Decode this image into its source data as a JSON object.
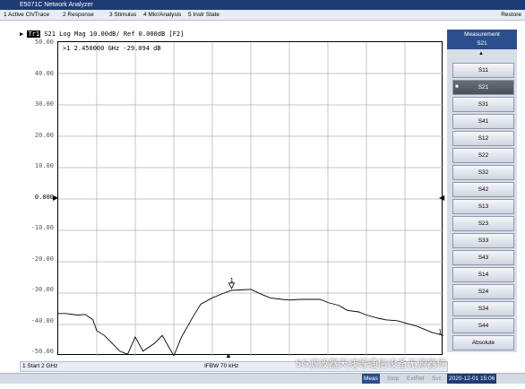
{
  "window": {
    "title": "E5071C Network Analyzer"
  },
  "menu": {
    "items": [
      "1 Active Ch/Trace",
      "2 Response",
      "3 Stimulus",
      "4 Mkr/Analysis",
      "5 Instr State"
    ],
    "right": "Restore"
  },
  "trace_header": {
    "trace_tag": "Tr1",
    "text": "S21 Log Mag 10.00dB/ Ref 0.000dB [F2]"
  },
  "marker_readout": ">1  2.450000 GHz -29.094 dB",
  "marker_label": "1",
  "trace_end_label": "1",
  "chart_data": {
    "type": "line",
    "x": [
      2.0,
      2.02,
      2.05,
      2.07,
      2.09,
      2.1,
      2.12,
      2.14,
      2.16,
      2.18,
      2.2,
      2.22,
      2.25,
      2.27,
      2.3,
      2.32,
      2.35,
      2.37,
      2.4,
      2.43,
      2.45,
      2.47,
      2.5,
      2.53,
      2.55,
      2.58,
      2.6,
      2.63,
      2.65,
      2.68,
      2.7,
      2.73,
      2.75,
      2.78,
      2.8,
      2.83,
      2.85,
      2.88,
      2.9,
      2.93,
      2.95,
      2.97,
      3.0
    ],
    "y": [
      -36.5,
      -36.5,
      -37.0,
      -36.8,
      -38.5,
      -42.0,
      -43.5,
      -46.0,
      -48.5,
      -49.5,
      -44.0,
      -48.5,
      -46.0,
      -43.5,
      -50.0,
      -44.0,
      -37.5,
      -33.5,
      -31.5,
      -30.0,
      -29.1,
      -29.0,
      -28.8,
      -30.5,
      -31.5,
      -32.0,
      -32.2,
      -32.0,
      -32.0,
      -32.0,
      -33.0,
      -34.0,
      -35.5,
      -36.0,
      -37.0,
      -38.0,
      -38.5,
      -38.8,
      -39.5,
      -40.5,
      -41.5,
      -42.5,
      -43.5
    ],
    "ylim": [
      -50,
      50
    ],
    "xlim": [
      2.0,
      3.0
    ],
    "y_ticks": [
      "50.00",
      "40.00",
      "30.00",
      "20.00",
      "10.00",
      "0.000",
      "-10.00",
      "-20.00",
      "-30.00",
      "-40.00",
      "-50.00"
    ],
    "grid": true,
    "color": "#000000"
  },
  "sidebar": {
    "header_line1": "Measurement",
    "header_line2": "S21",
    "buttons": [
      "S11",
      "S21",
      "S31",
      "S41",
      "S12",
      "S22",
      "S32",
      "S42",
      "S13",
      "S23",
      "S33",
      "S43",
      "S14",
      "S24",
      "S34",
      "S44",
      "Absolute"
    ],
    "selected": "S21"
  },
  "status_bottom1": {
    "left": "1  Start 2 GHz",
    "center": "IFBW 70 kHz"
  },
  "status_bottom2": {
    "items": [
      "Meas",
      "Stop",
      "ExtRef",
      "Svc"
    ],
    "datetime": "2020-12-01 15:06"
  },
  "watermark": "5G滤波器天线等通信设备无源器件",
  "colors": {
    "titlebar": "#1f3b73",
    "sidebar_header": "#2d4e8c",
    "selected_button": "#555a63"
  }
}
